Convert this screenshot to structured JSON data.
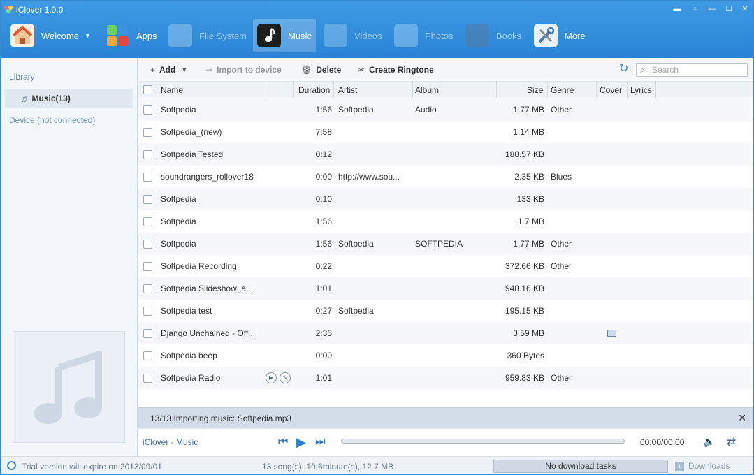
{
  "app": {
    "title": "iClover 1.0.0"
  },
  "window_controls": [
    {
      "name": "feedback-icon",
      "glyph": "▬"
    },
    {
      "name": "menu-icon",
      "glyph": "⩡"
    },
    {
      "name": "minimize-icon",
      "glyph": "—"
    },
    {
      "name": "maximize-icon",
      "glyph": "☐"
    },
    {
      "name": "close-icon",
      "glyph": "✕"
    }
  ],
  "nav": [
    {
      "label": "Welcome",
      "state": "normal",
      "dropdown": true
    },
    {
      "label": "Apps",
      "state": "normal"
    },
    {
      "label": "File System",
      "state": "disabled"
    },
    {
      "label": "Music",
      "state": "active"
    },
    {
      "label": "Videos",
      "state": "disabled"
    },
    {
      "label": "Photos",
      "state": "disabled"
    },
    {
      "label": "Books",
      "state": "disabled"
    },
    {
      "label": "More",
      "state": "normal"
    }
  ],
  "sidebar": {
    "library_heading": "Library",
    "music_item": "Music(13)",
    "device_heading": "Device (not connected)"
  },
  "toolbar": {
    "add": "Add",
    "import": "Import to device",
    "delete": "Delete",
    "ringtone": "Create Ringtone",
    "search_placeholder": "Search"
  },
  "columns": {
    "name": "Name",
    "duration": "Duration",
    "artist": "Artist",
    "album": "Album",
    "size": "Size",
    "genre": "Genre",
    "cover": "Cover",
    "lyrics": "Lyrics"
  },
  "rows": [
    {
      "name": "Softpedia",
      "duration": "1:56",
      "artist": "Softpedia",
      "album": "Audio",
      "size": "1.77 MB",
      "genre": "Other",
      "cover": false
    },
    {
      "name": "Softpedia_(new)",
      "duration": "7:58",
      "artist": "",
      "album": "",
      "size": "1.14 MB",
      "genre": "",
      "cover": false
    },
    {
      "name": "Softpedia Tested",
      "duration": "0:12",
      "artist": "",
      "album": "",
      "size": "188.57 KB",
      "genre": "",
      "cover": false
    },
    {
      "name": "soundrangers_rollover18",
      "duration": "0:00",
      "artist": "http://www.sou...",
      "album": "",
      "size": "2.35 KB",
      "genre": "Blues",
      "cover": false
    },
    {
      "name": "Softpedia",
      "duration": "0:10",
      "artist": "",
      "album": "",
      "size": "133 KB",
      "genre": "",
      "cover": false
    },
    {
      "name": "Softpedia",
      "duration": "1:56",
      "artist": "",
      "album": "",
      "size": "1.7 MB",
      "genre": "",
      "cover": false
    },
    {
      "name": "Softpedia",
      "duration": "1:56",
      "artist": "Softpedia",
      "album": "SOFTPEDIA",
      "size": "1.77 MB",
      "genre": "Other",
      "cover": false
    },
    {
      "name": "Softpedia Recording",
      "duration": "0:22",
      "artist": "",
      "album": "",
      "size": "372.66 KB",
      "genre": "Other",
      "cover": false
    },
    {
      "name": "Softpedia Slideshow_a...",
      "duration": "1:01",
      "artist": "",
      "album": "",
      "size": "948.16 KB",
      "genre": "",
      "cover": false
    },
    {
      "name": "Softpedia test",
      "duration": "0:27",
      "artist": "Softpedia",
      "album": "",
      "size": "195.15 KB",
      "genre": "",
      "cover": false
    },
    {
      "name": "Django Unchained - Off...",
      "duration": "2:35",
      "artist": "",
      "album": "",
      "size": "3.59 MB",
      "genre": "",
      "cover": true
    },
    {
      "name": "Softpedia beep",
      "duration": "0:00",
      "artist": "",
      "album": "",
      "size": "360 Bytes",
      "genre": "",
      "cover": false
    },
    {
      "name": "Softpedia Radio",
      "duration": "1:01",
      "artist": "",
      "album": "",
      "size": "959.83 KB",
      "genre": "Other",
      "cover": false,
      "hover_actions": true
    }
  ],
  "import_status": "13/13 Importing music: Softpedia.mp3",
  "player": {
    "label": "iClover - Music",
    "time": "00:00/00:00",
    "progress": 0
  },
  "footer": {
    "trial": "Trial version will expire on 2013/09/01",
    "counts": "13 song(s), 19.6minute(s), 12.7 MB",
    "downloads_status": "No download tasks",
    "downloads_button": "Downloads"
  }
}
